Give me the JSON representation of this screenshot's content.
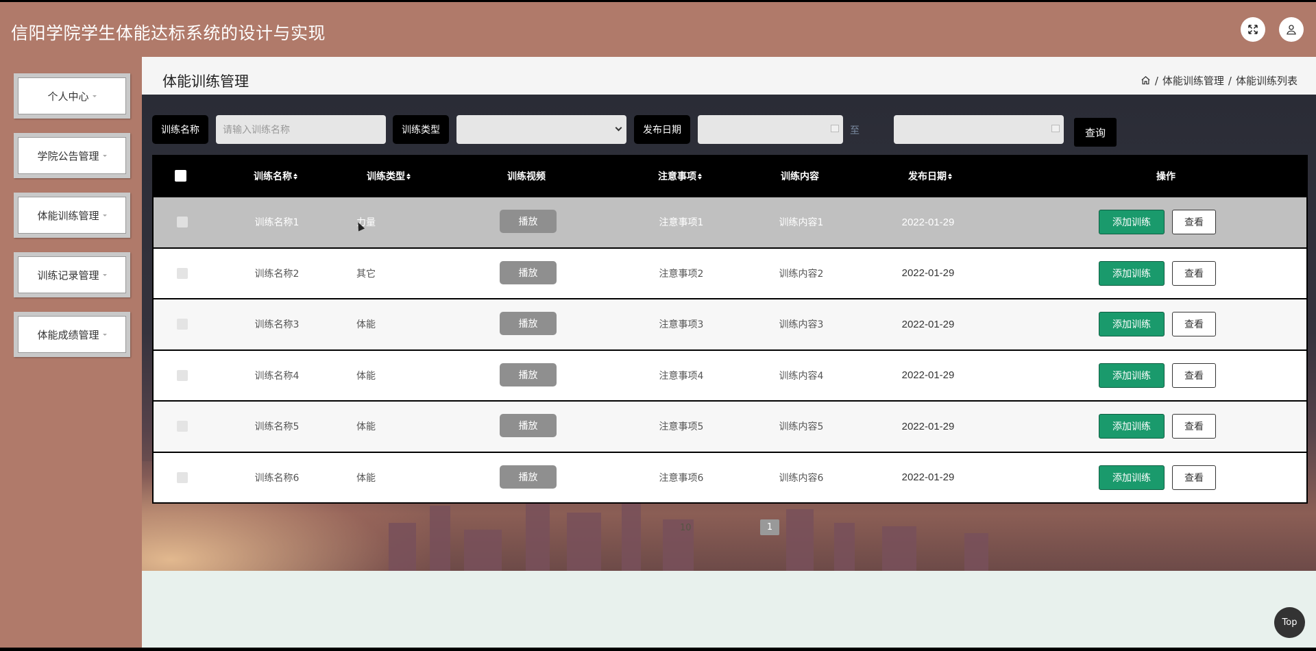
{
  "app": {
    "title": "信阳学院学生体能达标系统的设计与实现"
  },
  "header_icons": {
    "fullscreen": "fullscreen-icon",
    "user": "user-icon"
  },
  "sidebar": {
    "items": [
      {
        "label": "个人中心"
      },
      {
        "label": "学院公告管理"
      },
      {
        "label": "体能训练管理"
      },
      {
        "label": "训练记录管理"
      },
      {
        "label": "体能成绩管理"
      }
    ]
  },
  "page": {
    "title": "体能训练管理",
    "breadcrumb": {
      "level1": "体能训练管理",
      "level2": "体能训练列表",
      "sep": "/"
    }
  },
  "search": {
    "name_label": "训练名称",
    "name_placeholder": "请输入训练名称",
    "type_label": "训练类型",
    "type_value": "",
    "date_label": "发布日期",
    "date_from": "",
    "date_to_sep": "至",
    "date_to": "",
    "query_label": "查询"
  },
  "table": {
    "headers": {
      "name": "训练名称",
      "type": "训练类型",
      "video": "训练视频",
      "notes": "注意事项",
      "content": "训练内容",
      "date": "发布日期",
      "actions": "操作"
    },
    "play_label": "播放",
    "add_label": "添加训练",
    "view_label": "查看",
    "rows": [
      {
        "name": "训练名称1",
        "type": "力量",
        "notes": "注意事项1",
        "content": "训练内容1",
        "date": "2022-01-29"
      },
      {
        "name": "训练名称2",
        "type": "其它",
        "notes": "注意事项2",
        "content": "训练内容2",
        "date": "2022-01-29"
      },
      {
        "name": "训练名称3",
        "type": "体能",
        "notes": "注意事项3",
        "content": "训练内容3",
        "date": "2022-01-29"
      },
      {
        "name": "训练名称4",
        "type": "体能",
        "notes": "注意事项4",
        "content": "训练内容4",
        "date": "2022-01-29"
      },
      {
        "name": "训练名称5",
        "type": "体能",
        "notes": "注意事项5",
        "content": "训练内容5",
        "date": "2022-01-29"
      },
      {
        "name": "训练名称6",
        "type": "体能",
        "notes": "注意事项6",
        "content": "训练内容6",
        "date": "2022-01-29"
      }
    ]
  },
  "pagination": {
    "page_size": "10",
    "current_page": "1"
  },
  "back_to_top": "Top",
  "colors": {
    "header_bg": "#b07a6a",
    "add_button": "#1a9a6c",
    "table_header": "#000000"
  }
}
